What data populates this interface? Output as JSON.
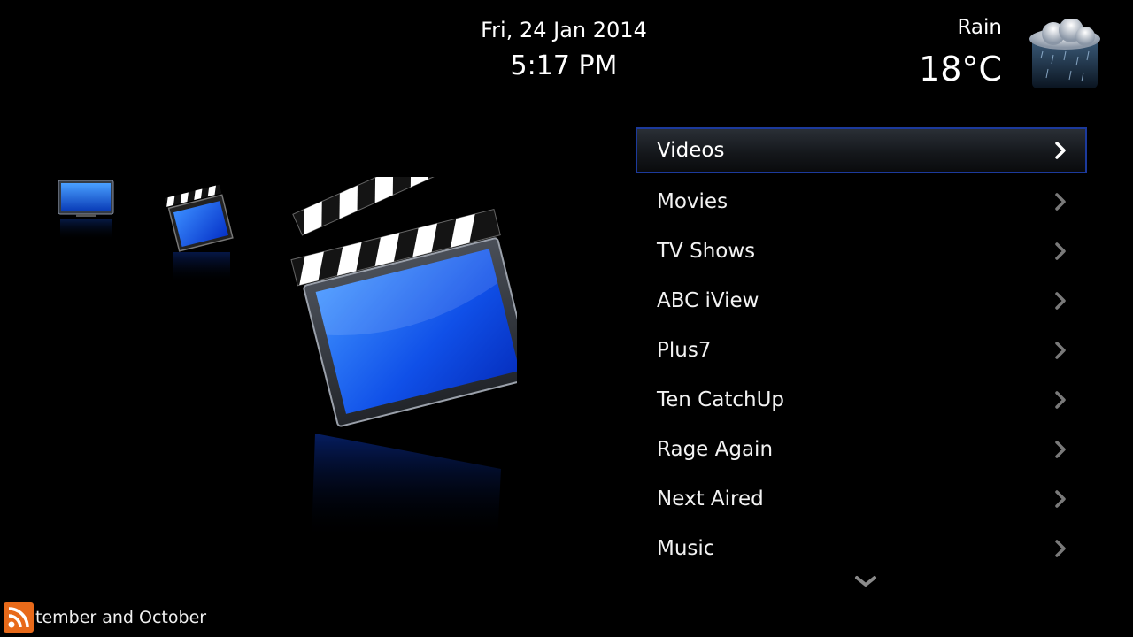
{
  "header": {
    "date": "Fri, 24 Jan 2014",
    "time": "5:17 PM"
  },
  "weather": {
    "condition": "Rain",
    "temperature": "18°C",
    "icon": "rain-cloud-icon"
  },
  "preview_icons": [
    "tv-icon",
    "clapperboard-icon",
    "clapperboard-icon"
  ],
  "menu": {
    "items": [
      {
        "label": "Videos",
        "selected": true
      },
      {
        "label": "Movies"
      },
      {
        "label": "TV Shows"
      },
      {
        "label": "ABC iView"
      },
      {
        "label": "Plus7"
      },
      {
        "label": "Ten CatchUp"
      },
      {
        "label": "Rage Again"
      },
      {
        "label": "Next Aired"
      },
      {
        "label": "Music"
      }
    ],
    "accent_color": "#1c3a9c"
  },
  "ticker": {
    "text": "tember and October",
    "icon": "rss-icon",
    "icon_color": "#e86a1a"
  }
}
